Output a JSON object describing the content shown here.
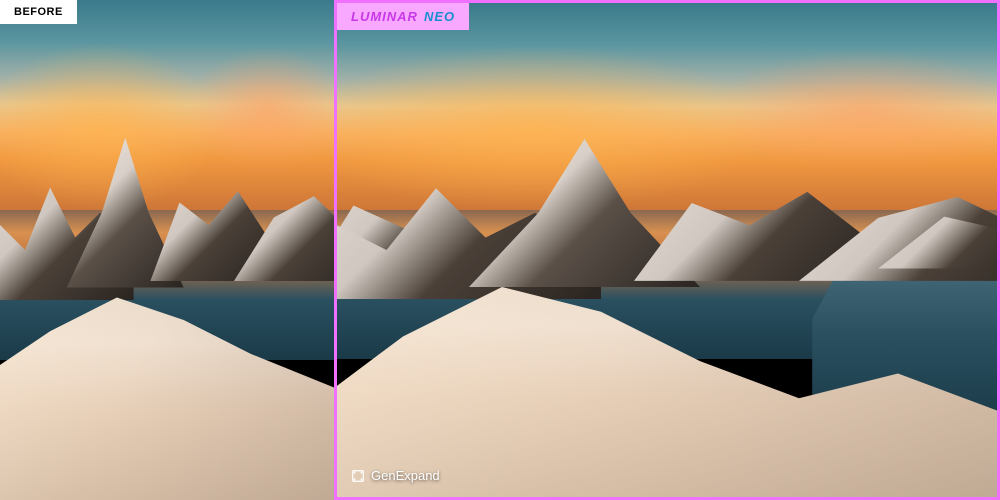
{
  "comparison": {
    "before_label": "BEFORE",
    "brand": {
      "word1": "LUMINAR",
      "word2": "NEO"
    },
    "feature_name": "GenExpand",
    "colors": {
      "border_accent": "#f070ff",
      "brand_bg": "#f8a8ff",
      "brand_word1": "#c838e8",
      "brand_word2": "#1890d0"
    }
  }
}
